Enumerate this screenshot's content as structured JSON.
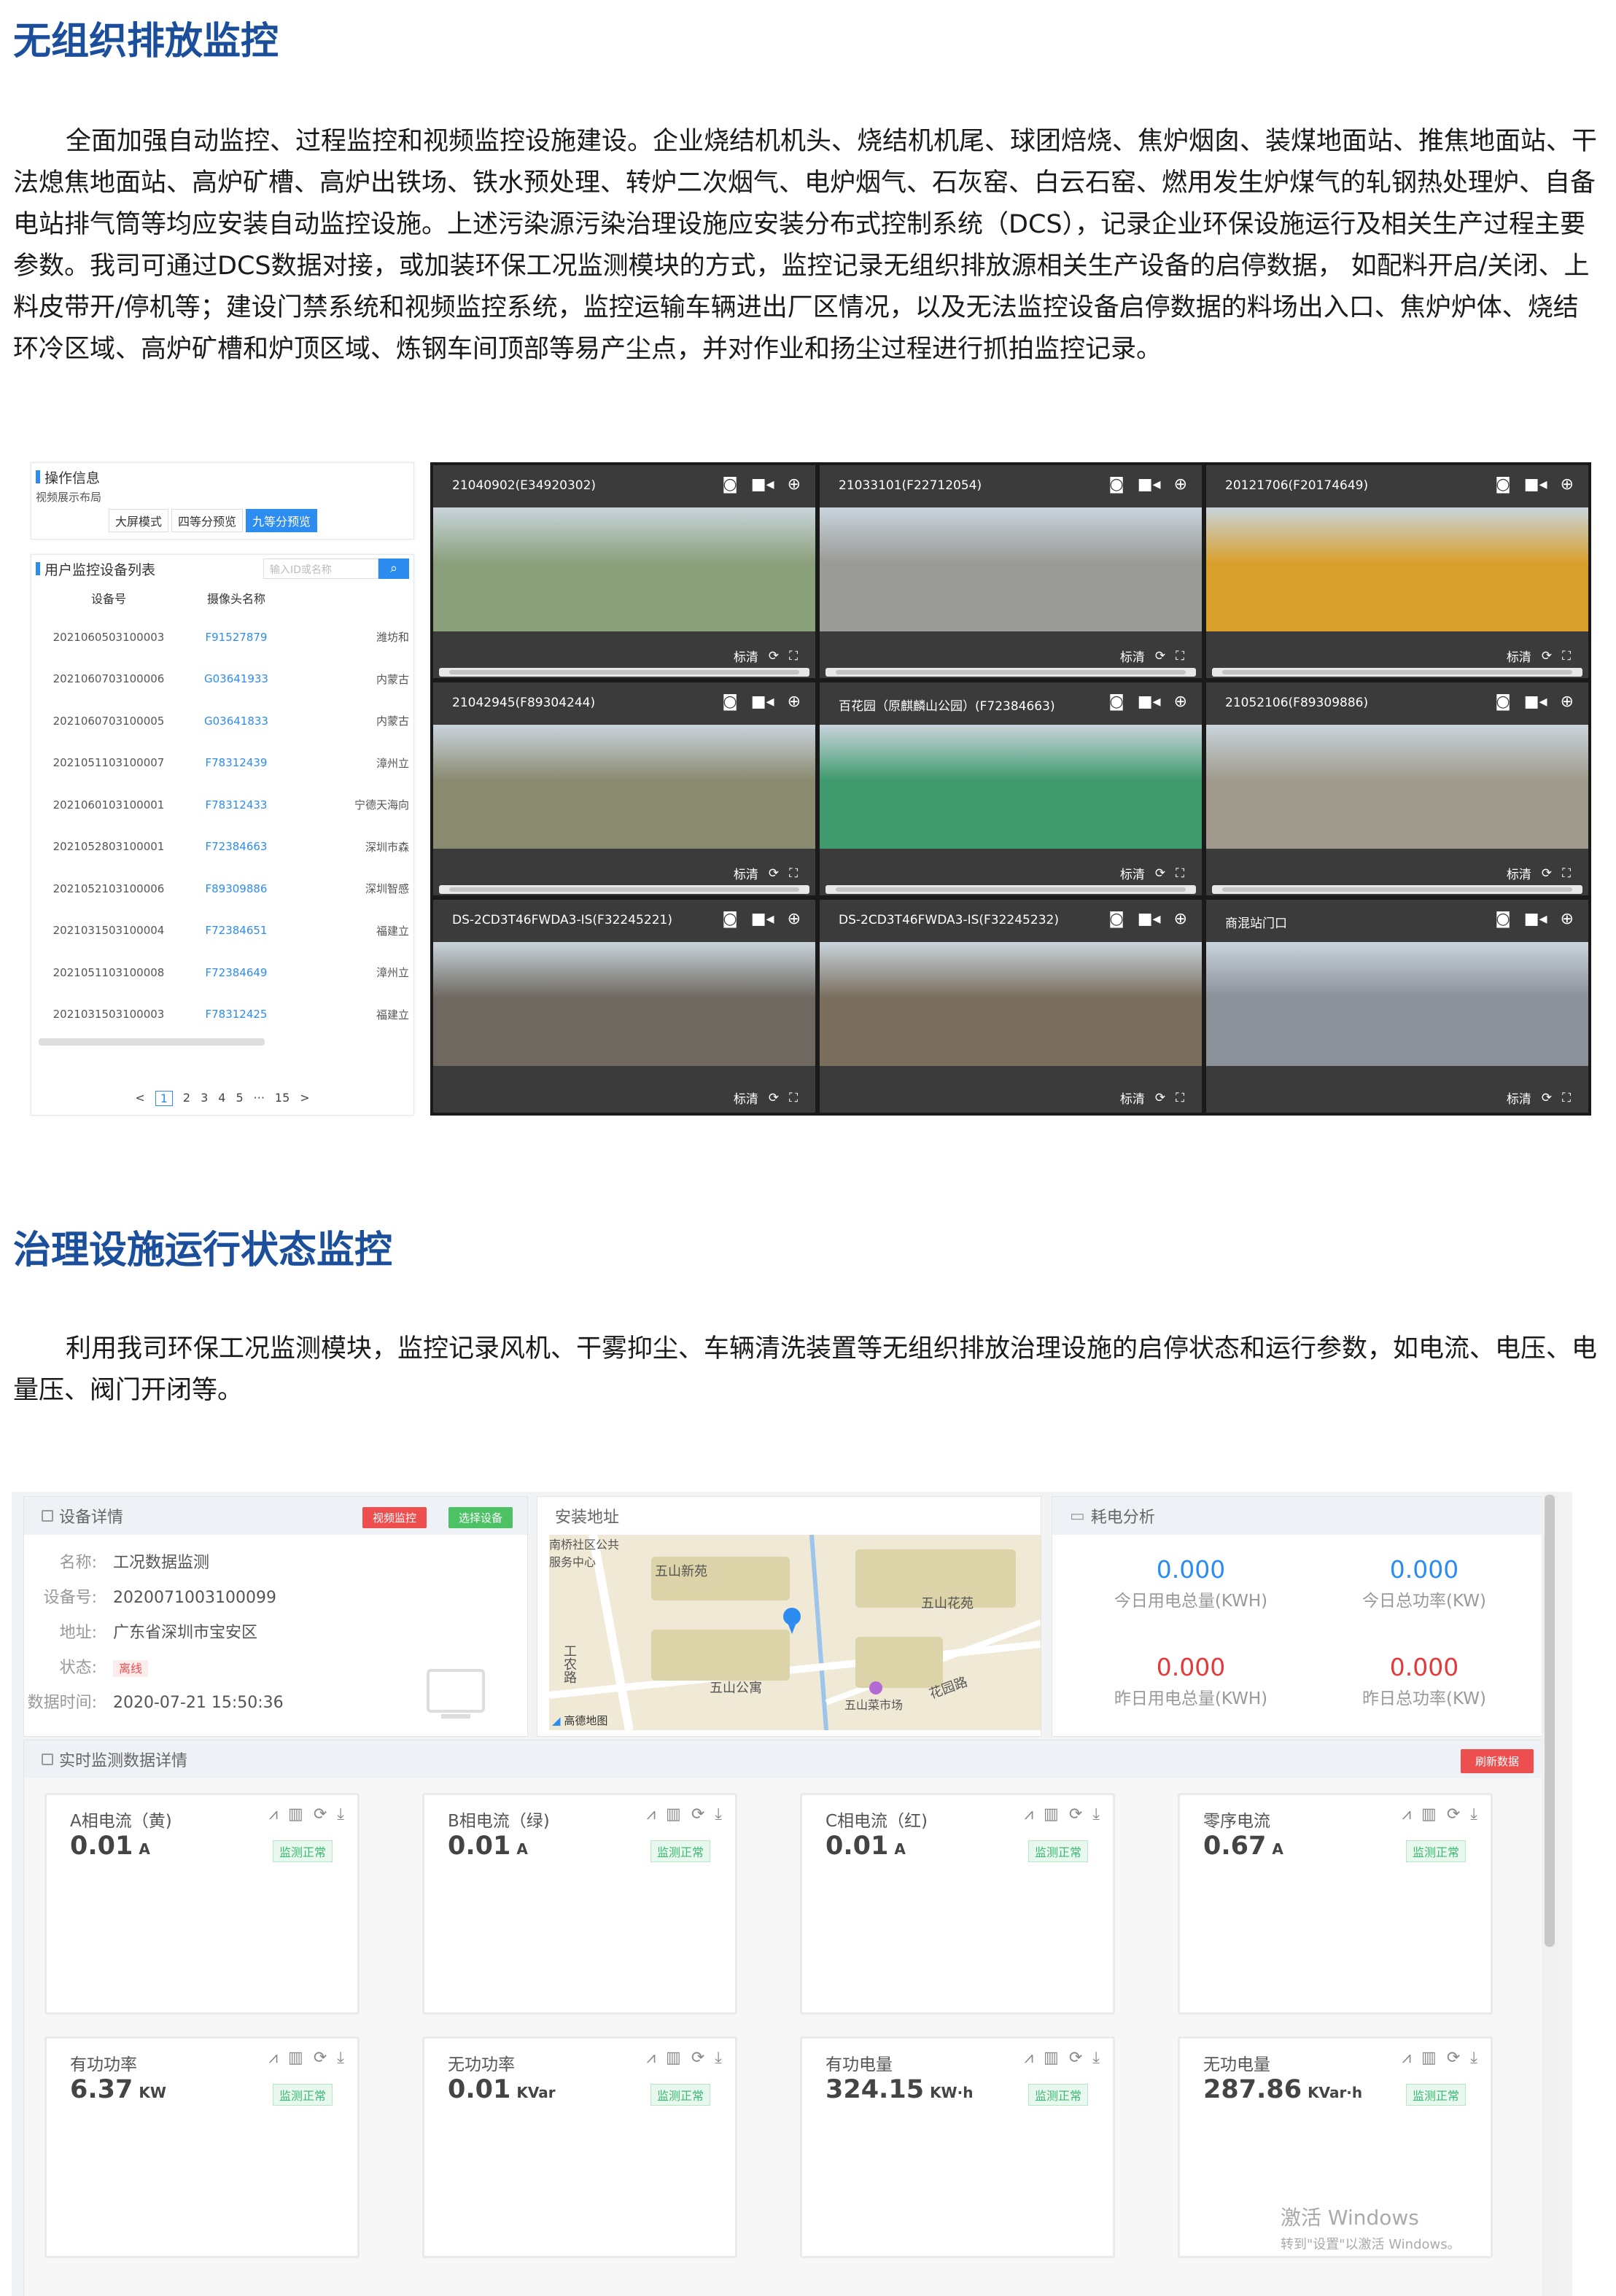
{
  "section1": {
    "title": "无组织排放监控",
    "paragraph": "全面加强自动监控、过程监控和视频监控设施建设。企业烧结机机头、烧结机机尾、球团焙烧、焦炉烟囱、装煤地面站、推焦地面站、干法熄焦地面站、高炉矿槽、高炉出铁场、铁水预处理、转炉二次烟气、电炉烟气、石灰窑、白云石窑、燃用发生炉煤气的轧钢热处理炉、自备电站排气筒等均应安装自动监控设施。上述污染源污染治理设施应安装分布式控制系统（DCS），记录企业环保设施运行及相关生产过程主要参数。我司可通过DCS数据对接，或加装环保工况监测模块的方式，监控记录无组织排放源相关生产设备的启停数据， 如配料开启/关闭、上料皮带开/停机等；建设门禁系统和视频监控系统，监控运输车辆进出厂区情况，以及无法监控设备启停数据的料场出入口、焦炉炉体、烧结环冷区域、高炉矿槽和炉顶区域、炼钢车间顶部等易产尘点，并对作业和扬尘过程进行抓拍监控记录。"
  },
  "shot1": {
    "ops_title": "操作信息",
    "layout_label": "视频展示布局",
    "layout_buttons": [
      "大屏模式",
      "四等分预览",
      "九等分预览"
    ],
    "list_title": "用户监控设备列表",
    "search_placeholder": "输入ID或名称",
    "search_icon": "search-icon",
    "columns": [
      "设备号",
      "摄像头名称"
    ],
    "rows": [
      {
        "id": "2021060503100003",
        "cam": "F91527879",
        "loc": "潍坊和"
      },
      {
        "id": "2021060703100006",
        "cam": "G03641933",
        "loc": "内蒙古"
      },
      {
        "id": "2021060703100005",
        "cam": "G03641833",
        "loc": "内蒙古"
      },
      {
        "id": "2021051103100007",
        "cam": "F78312439",
        "loc": "漳州立"
      },
      {
        "id": "2021060103100001",
        "cam": "F78312433",
        "loc": "宁德天海向"
      },
      {
        "id": "2021052803100001",
        "cam": "F72384663",
        "loc": "深圳市森"
      },
      {
        "id": "2021052103100006",
        "cam": "F89309886",
        "loc": "深圳智感"
      },
      {
        "id": "2021031503100004",
        "cam": "F72384651",
        "loc": "福建立"
      },
      {
        "id": "2021051103100008",
        "cam": "F72384649",
        "loc": "漳州立"
      },
      {
        "id": "2021031503100003",
        "cam": "F78312425",
        "loc": "福建立"
      }
    ],
    "pager": [
      "<",
      "1",
      "2",
      "3",
      "4",
      "5",
      "···",
      "15",
      ">"
    ],
    "video_bar_label": "标清",
    "videos": [
      {
        "title": "21040902(E34920302)",
        "scene": "#8aa07a"
      },
      {
        "title": "21033101(F22712054)",
        "scene": "#9a9a96"
      },
      {
        "title": "20121706(F20174649)",
        "scene": "#d8a02a"
      },
      {
        "title": "21042945(F89304244)",
        "scene": "#8a8a70"
      },
      {
        "title": "百花园（原麒麟山公园）(F72384663)",
        "scene": "#3f9a6e"
      },
      {
        "title": "21052106(F89309886)",
        "scene": "#a09a8c"
      },
      {
        "title": "DS-2CD3T46FWDA3-IS(F32245221)",
        "scene": "#6e6860"
      },
      {
        "title": "DS-2CD3T46FWDA3-IS(F32245232)",
        "scene": "#7a6e5e"
      },
      {
        "title": "商混站门口",
        "scene": "#8c9098"
      }
    ]
  },
  "section2": {
    "title": "治理设施运行状态监控",
    "paragraph": "利用我司环保工况监测模块，监控记录风机、干雾抑尘、车辆清洗装置等无组织排放治理设施的启停状态和运行参数，如电流、电压、电量压、阀门开闭等。"
  },
  "shot2": {
    "device": {
      "title": "设备详情",
      "btn_video": "视频监控",
      "btn_select": "选择设备",
      "fields": [
        {
          "label": "名称:",
          "value": "工况数据监测"
        },
        {
          "label": "设备号:",
          "value": "2020071003100099"
        },
        {
          "label": "地址:",
          "value": "广东省深圳市宝安区"
        },
        {
          "label": "状态:",
          "value": "离线"
        },
        {
          "label": "数据时间:",
          "value": "2020-07-21 15:50:36"
        }
      ]
    },
    "map": {
      "title": "安装地址",
      "labels": [
        "南桥社区公共服务中心",
        "五山新苑",
        "五山花苑",
        "五山公寓",
        "工农路",
        "五山菜市场",
        "花园路",
        "高德地图"
      ]
    },
    "analysis": {
      "title": "耗电分析",
      "items": [
        {
          "value": "0.000",
          "label": "今日用电总量(KWH)",
          "color": "#2d8cf0"
        },
        {
          "value": "0.000",
          "label": "今日总功率(KW)",
          "color": "#2d8cf0"
        },
        {
          "value": "0.000",
          "label": "昨日用电总量(KWH)",
          "color": "#e23a3a"
        },
        {
          "value": "0.000",
          "label": "昨日总功率(KW)",
          "color": "#e23a3a"
        }
      ]
    },
    "realtime": {
      "title": "实时监测数据详情",
      "refresh": "刷新数据",
      "status": "监测正常",
      "metrics": [
        {
          "name": "A相电流（黄)",
          "value": "0.01",
          "unit": "A"
        },
        {
          "name": "B相电流（绿)",
          "value": "0.01",
          "unit": "A"
        },
        {
          "name": "C相电流（红)",
          "value": "0.01",
          "unit": "A"
        },
        {
          "name": "零序电流",
          "value": "0.67",
          "unit": "A"
        },
        {
          "name": "有功功率",
          "value": "6.37",
          "unit": "KW"
        },
        {
          "name": "无功功率",
          "value": "0.01",
          "unit": "KVar"
        },
        {
          "name": "有功电量",
          "value": "324.15",
          "unit": "KW·h"
        },
        {
          "name": "无功电量",
          "value": "287.86",
          "unit": "KVar·h"
        }
      ]
    },
    "watermark": {
      "line1": "激活 Windows",
      "line2": "转到\"设置\"以激活 Windows。"
    }
  }
}
